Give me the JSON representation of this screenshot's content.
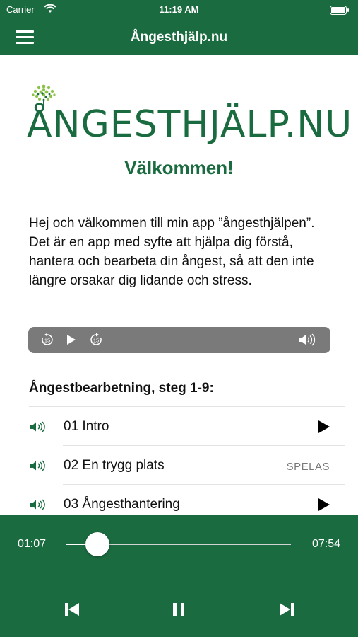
{
  "status_bar": {
    "carrier": "Carrier",
    "time": "11:19 AM"
  },
  "nav": {
    "title": "Ångesthjälp.nu"
  },
  "logo": {
    "text": "ÅNGESTHJÄLP.NU"
  },
  "welcome": "Välkommen!",
  "intro": "Hej och välkommen till min app ”ångesthjälpen”. Det är en app med syfte att hjälpa dig förstå, hantera och bearbeta din ångest, så att den inte längre orsakar dig lidande och stress.",
  "audio_player": {
    "rewind_seconds": "15",
    "forward_seconds": "15"
  },
  "section": {
    "heading": "Ångestbearbetning, steg 1-9:"
  },
  "tracks": [
    {
      "label": "01 Intro",
      "status": ""
    },
    {
      "label": "02 En trygg plats",
      "status": "SPELAS"
    },
    {
      "label": "03 Ångesthantering",
      "status": ""
    }
  ],
  "player": {
    "elapsed": "01:07",
    "total": "07:54",
    "progress": 0.141
  },
  "colors": {
    "brand_green": "#1a6b3f",
    "player_gray": "#7a7a7a"
  },
  "icons": [
    "wifi-icon",
    "battery-icon",
    "menu-icon",
    "tree-icon",
    "rewind-icon",
    "play-icon",
    "forward-icon",
    "volume-icon",
    "speaker-icon",
    "skip-previous-icon",
    "pause-icon",
    "skip-next-icon"
  ]
}
